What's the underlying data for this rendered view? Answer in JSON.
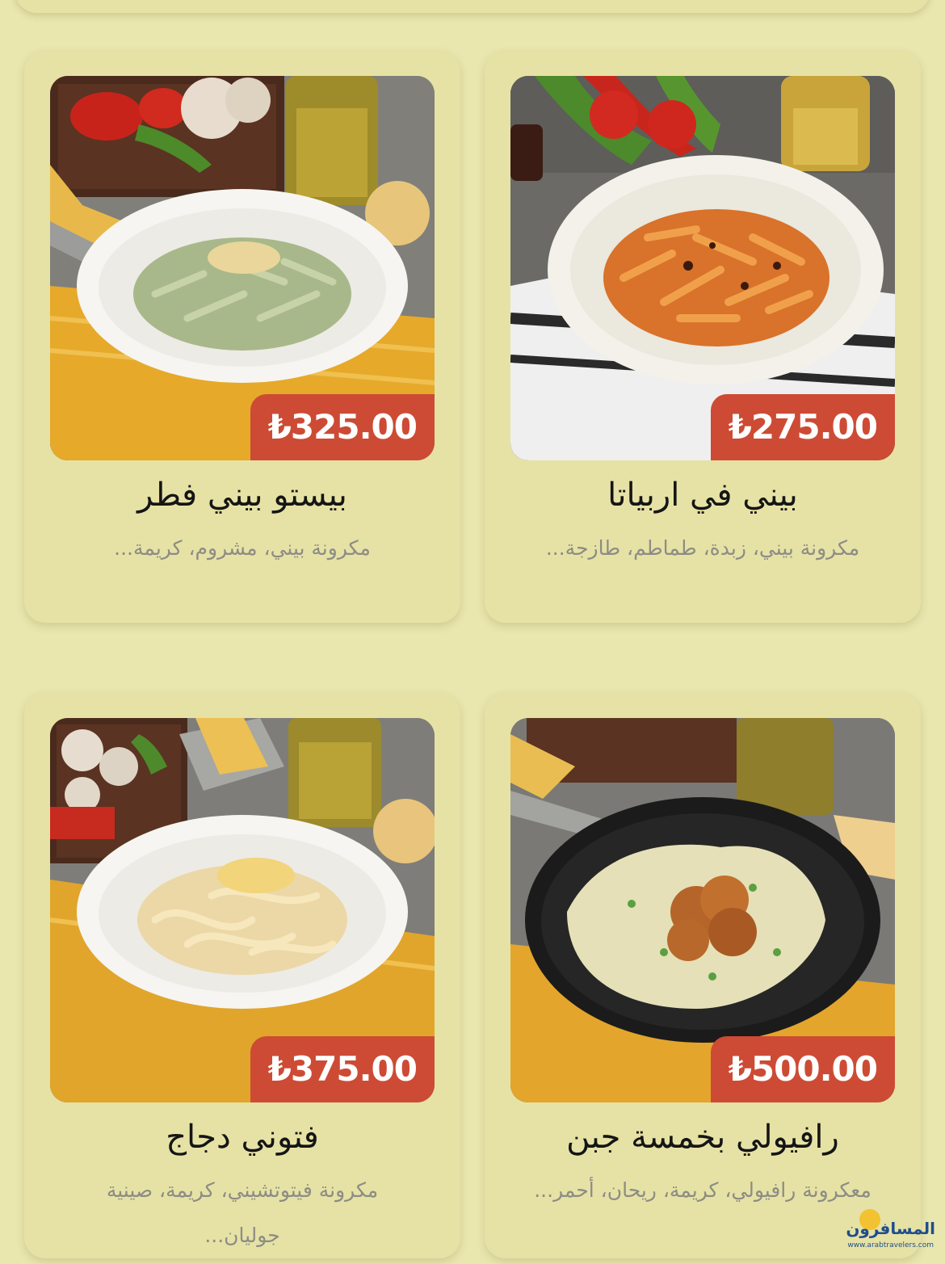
{
  "menu": {
    "items": [
      {
        "title": "بيني في اربياتا",
        "description": "مكرونة بيني، زبدة، طماطم، طازجة...",
        "price": "₺275.00",
        "photo": "penne-arrabbiata-photo"
      },
      {
        "title": "بيستو بيني فطر",
        "description": "مكرونة بيني، مشروم، كريمة...",
        "price": "₺325.00",
        "photo": "pesto-penne-mushroom-photo"
      },
      {
        "title": "رافيولي بخمسة جبن",
        "description": "معكرونة رافيولي، كريمة، ريحان، أحمر...",
        "price": "₺500.00",
        "photo": "five-cheese-ravioli-photo"
      },
      {
        "title": "فتوني دجاج",
        "description": "مكرونة فيتوتشيني، كريمة، صينية جوليان...",
        "price": "₺375.00",
        "photo": "chicken-fettuccine-photo"
      }
    ]
  },
  "watermark": {
    "brand": "المسافرون",
    "url": "www.arabtravelers.com"
  },
  "colors": {
    "page_background": "#e9e6ae",
    "card_background": "#e6e2a5",
    "price_badge": "#cd4b34",
    "title_text": "#151515",
    "description_text": "#8d8c84"
  }
}
